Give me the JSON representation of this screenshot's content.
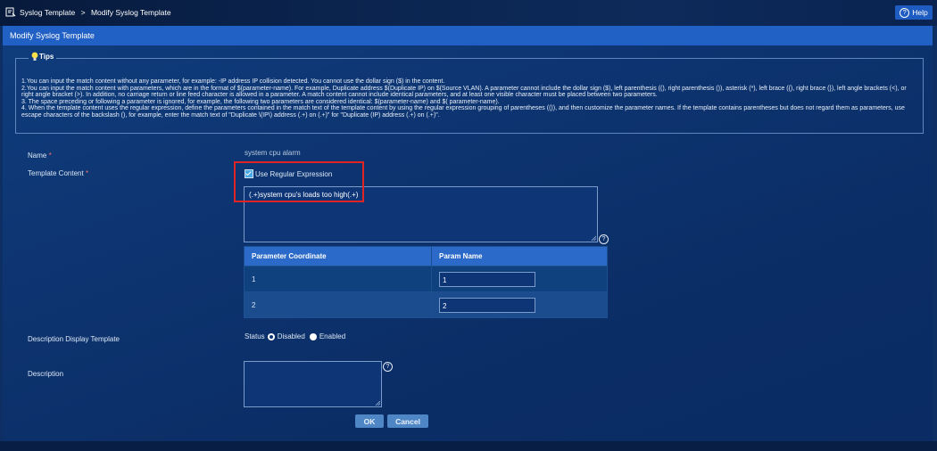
{
  "breadcrumb": {
    "items": [
      "Syslog Template",
      ">",
      "Modify Syslog Template"
    ]
  },
  "help": {
    "label": "Help"
  },
  "panel": {
    "title": "Modify Syslog Template"
  },
  "tips": {
    "title": "Tips",
    "lines": [
      "1.You can input the match content without any parameter, for example: -IP address IP collision detected. You cannot use the dollar sign ($) in the content.",
      "2.You can input the match content with parameters, which are in the format of $(parameter-name). For example, Duplicate address $(Duplicate IP) on $(Source VLAN). A parameter cannot include the dollar sign ($), left parenthesis ((), right parenthesis ()), asterisk (*), left brace ({), right brace (}), left angle brackets (<), or right angle bracket (>). In addition, no carriage return or line feed character is allowed in a parameter. A match content cannot include identical parameters, and at least one visible character must be placed between two parameters.",
      "3. The space preceding or following a parameter is ignored, for example, the following two parameters are considered identical: $(parameter-name) and $( parameter-name).",
      "4. When the template content uses the regular expression, define the parameters contained in the match text of the template content by using the regular expression grouping of parentheses (()), and then customize the parameter names. If the template contains parentheses but does not regard them as parameters, use escape characters of the backslash (), for example, enter the match text of \"Duplicate \\(IP\\) address (.+) on (.+)\" for \"Duplicate (IP) address (.+) on (.+)\"."
    ]
  },
  "form": {
    "name_label": "Name",
    "required_mark": "*",
    "name_value": "system cpu alarm",
    "template_content_label": "Template Content",
    "use_regex_label": "Use Regular Expression",
    "use_regex_checked": true,
    "template_content_value": "(.+)system cpu's loads too high(.+)",
    "param_table": {
      "headers": [
        "Parameter Coordinate",
        "Param Name"
      ],
      "rows": [
        {
          "coordinate": "1",
          "name": "1"
        },
        {
          "coordinate": "2",
          "name": "2"
        }
      ]
    },
    "desc_display_label": "Description Display Template",
    "status_label": "Status",
    "status_options": [
      "Disabled",
      "Enabled"
    ],
    "status_selected": "Disabled",
    "description_label": "Description",
    "description_value": ""
  },
  "buttons": {
    "ok": "OK",
    "cancel": "Cancel"
  },
  "colors": {
    "panel_header": "#2160c4",
    "highlight_box": "#e02424",
    "button": "#4f86c6"
  }
}
